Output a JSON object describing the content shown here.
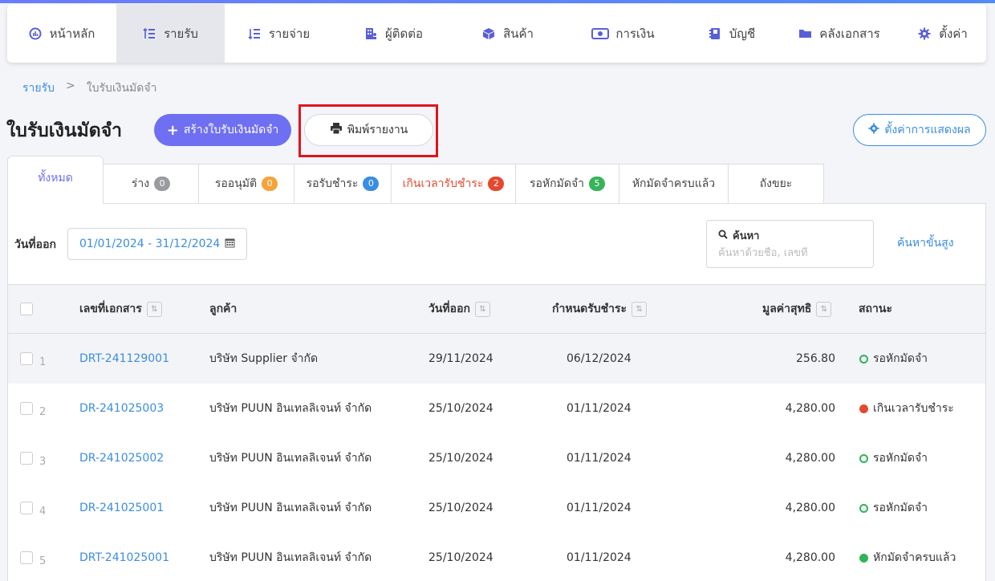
{
  "colors": {
    "accent": "#6f6ff2",
    "link": "#3b8de0",
    "danger": "#e5482f",
    "success": "#2fb45a",
    "badge_gray": "#9a9ba0",
    "badge_orange": "#f5a33a",
    "badge_blue": "#3b8de0",
    "badge_red": "#e5482f",
    "badge_green": "#37b35b"
  },
  "nav": [
    {
      "label": "หน้าหลัก",
      "icon": "dashboard-icon"
    },
    {
      "label": "รายรับ",
      "icon": "income-icon"
    },
    {
      "label": "รายจ่าย",
      "icon": "expense-icon"
    },
    {
      "label": "ผู้ติดต่อ",
      "icon": "contacts-icon"
    },
    {
      "label": "สินค้า",
      "icon": "box-icon"
    },
    {
      "label": "การเงิน",
      "icon": "money-icon"
    },
    {
      "label": "บัญชี",
      "icon": "ledger-icon"
    },
    {
      "label": "คลังเอกสาร",
      "icon": "folder-icon"
    },
    {
      "label": "ตั้งค่า",
      "icon": "gear-icon"
    }
  ],
  "breadcrumb": {
    "parent": "รายรับ",
    "separator": ">",
    "current": "ใบรับเงินมัดจำ"
  },
  "page": {
    "title": "ใบรับเงินมัดจำ",
    "create_button": "สร้างใบรับเงินมัดจำ",
    "print_button": "พิมพ์รายงาน",
    "display_settings_button": "ตั้งค่าการแสดงผล"
  },
  "tabs": [
    {
      "label": "ทั้งหมด"
    },
    {
      "label": "ร่าง",
      "count": "0"
    },
    {
      "label": "รออนุมัติ",
      "count": "0"
    },
    {
      "label": "รอรับชำระ",
      "count": "0"
    },
    {
      "label": "เกินเวลารับชำระ",
      "count": "2"
    },
    {
      "label": "รอหักมัดจำ",
      "count": "5"
    },
    {
      "label": "หักมัดจำครบแล้ว"
    },
    {
      "label": "ถังขยะ"
    }
  ],
  "filter": {
    "date_label": "วันที่ออก",
    "date_range": "01/01/2024 - 31/12/2024",
    "search_label": "ค้นหา",
    "search_placeholder": "ค้นหาด้วยชื่อ, เลขที่",
    "advanced_search": "ค้นหาขั้นสูง"
  },
  "table": {
    "headers": {
      "doc_no": "เลขที่เอกสาร",
      "customer": "ลูกค้า",
      "issue_date": "วันที่ออก",
      "due_date": "กำหนดรับชำระ",
      "net_value": "มูลค่าสุทธิ",
      "status": "สถานะ"
    },
    "rows": [
      {
        "num": "1",
        "doc_no": "DRT-241129001",
        "customer": "บริษัท Supplier จำกัด",
        "issue_date": "29/11/2024",
        "due_date": "06/12/2024",
        "net_value": "256.80",
        "status": "รอหักมัดจำ",
        "status_type": "ring"
      },
      {
        "num": "2",
        "doc_no": "DR-241025003",
        "customer": "บริษัท PUUN อินเทลลิเจนท์ จำกัด",
        "issue_date": "25/10/2024",
        "due_date": "01/11/2024",
        "net_value": "4,280.00",
        "status": "เกินเวลารับชำระ",
        "status_type": "red"
      },
      {
        "num": "3",
        "doc_no": "DR-241025002",
        "customer": "บริษัท PUUN อินเทลลิเจนท์ จำกัด",
        "issue_date": "25/10/2024",
        "due_date": "01/11/2024",
        "net_value": "4,280.00",
        "status": "รอหักมัดจำ",
        "status_type": "ring"
      },
      {
        "num": "4",
        "doc_no": "DR-241025001",
        "customer": "บริษัท PUUN อินเทลลิเจนท์ จำกัด",
        "issue_date": "25/10/2024",
        "due_date": "01/11/2024",
        "net_value": "4,280.00",
        "status": "รอหักมัดจำ",
        "status_type": "ring"
      },
      {
        "num": "5",
        "doc_no": "DRT-241025001",
        "customer": "บริษัท PUUN อินเทลลิเจนท์ จำกัด",
        "issue_date": "25/10/2024",
        "due_date": "01/11/2024",
        "net_value": "4,280.00",
        "status": "หักมัดจำครบแล้ว",
        "status_type": "green"
      }
    ]
  }
}
